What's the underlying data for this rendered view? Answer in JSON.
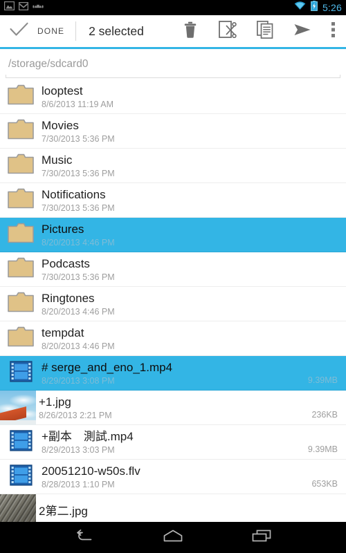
{
  "status_bar": {
    "icons": [
      "gallery-icon",
      "gmail-icon",
      "android-icon"
    ],
    "wifi_icon": "wifi-icon",
    "battery_icon": "battery-charging-icon",
    "time": "5:26",
    "time_color": "#4fb8e8"
  },
  "action_bar": {
    "done_icon": "check-icon",
    "done_label": "DONE",
    "selection_count": "2 selected",
    "actions": [
      {
        "name": "delete-button",
        "icon": "trash-icon"
      },
      {
        "name": "cut-button",
        "icon": "scissors-document-icon"
      },
      {
        "name": "copy-button",
        "icon": "copy-documents-icon"
      },
      {
        "name": "send-button",
        "icon": "send-paper-plane-icon"
      },
      {
        "name": "overflow-button",
        "icon": "overflow-menu-icon"
      }
    ],
    "accent_color": "#33b5e5"
  },
  "path_bar": {
    "path": "/storage/sdcard0"
  },
  "files": [
    {
      "name": "looptest",
      "date": "8/6/2013 11:19 AM",
      "size": "",
      "icon": "folder-icon",
      "selected": false
    },
    {
      "name": "Movies",
      "date": "7/30/2013 5:36 PM",
      "size": "",
      "icon": "folder-icon",
      "selected": false
    },
    {
      "name": "Music",
      "date": "7/30/2013 5:36 PM",
      "size": "",
      "icon": "folder-icon",
      "selected": false
    },
    {
      "name": "Notifications",
      "date": "7/30/2013 5:36 PM",
      "size": "",
      "icon": "folder-icon",
      "selected": false
    },
    {
      "name": "Pictures",
      "date": "8/20/2013 4:46 PM",
      "size": "",
      "icon": "folder-icon",
      "selected": true
    },
    {
      "name": "Podcasts",
      "date": "7/30/2013 5:36 PM",
      "size": "",
      "icon": "folder-icon",
      "selected": false
    },
    {
      "name": "Ringtones",
      "date": "8/20/2013 4:46 PM",
      "size": "",
      "icon": "folder-icon",
      "selected": false
    },
    {
      "name": "tempdat",
      "date": "8/20/2013 4:46 PM",
      "size": "",
      "icon": "folder-icon",
      "selected": false
    },
    {
      "name": "# serge_and_eno_1.mp4",
      "date": "8/29/2013 3:08 PM",
      "size": "9.39MB",
      "icon": "video-film-icon",
      "selected": true
    },
    {
      "name": "+1.jpg",
      "date": "8/26/2013 2:21 PM",
      "size": "236KB",
      "icon": "image-thumbnail-sky",
      "selected": false
    },
    {
      "name": "+副本　測試.mp4",
      "date": "8/29/2013 3:03 PM",
      "size": "9.39MB",
      "icon": "video-film-icon",
      "selected": false
    },
    {
      "name": "20051210-w50s.flv",
      "date": "8/28/2013 1:10 PM",
      "size": "653KB",
      "icon": "video-film-icon",
      "selected": false
    },
    {
      "name": "2第二.jpg",
      "date": "",
      "size": "",
      "icon": "image-thumbnail-rock",
      "selected": false
    }
  ],
  "nav_bar": {
    "back": "back-icon",
    "home": "home-icon",
    "recents": "recents-icon"
  },
  "colors": {
    "accent": "#33b5e5",
    "folder": "#e0c287",
    "divider": "#ededed"
  }
}
